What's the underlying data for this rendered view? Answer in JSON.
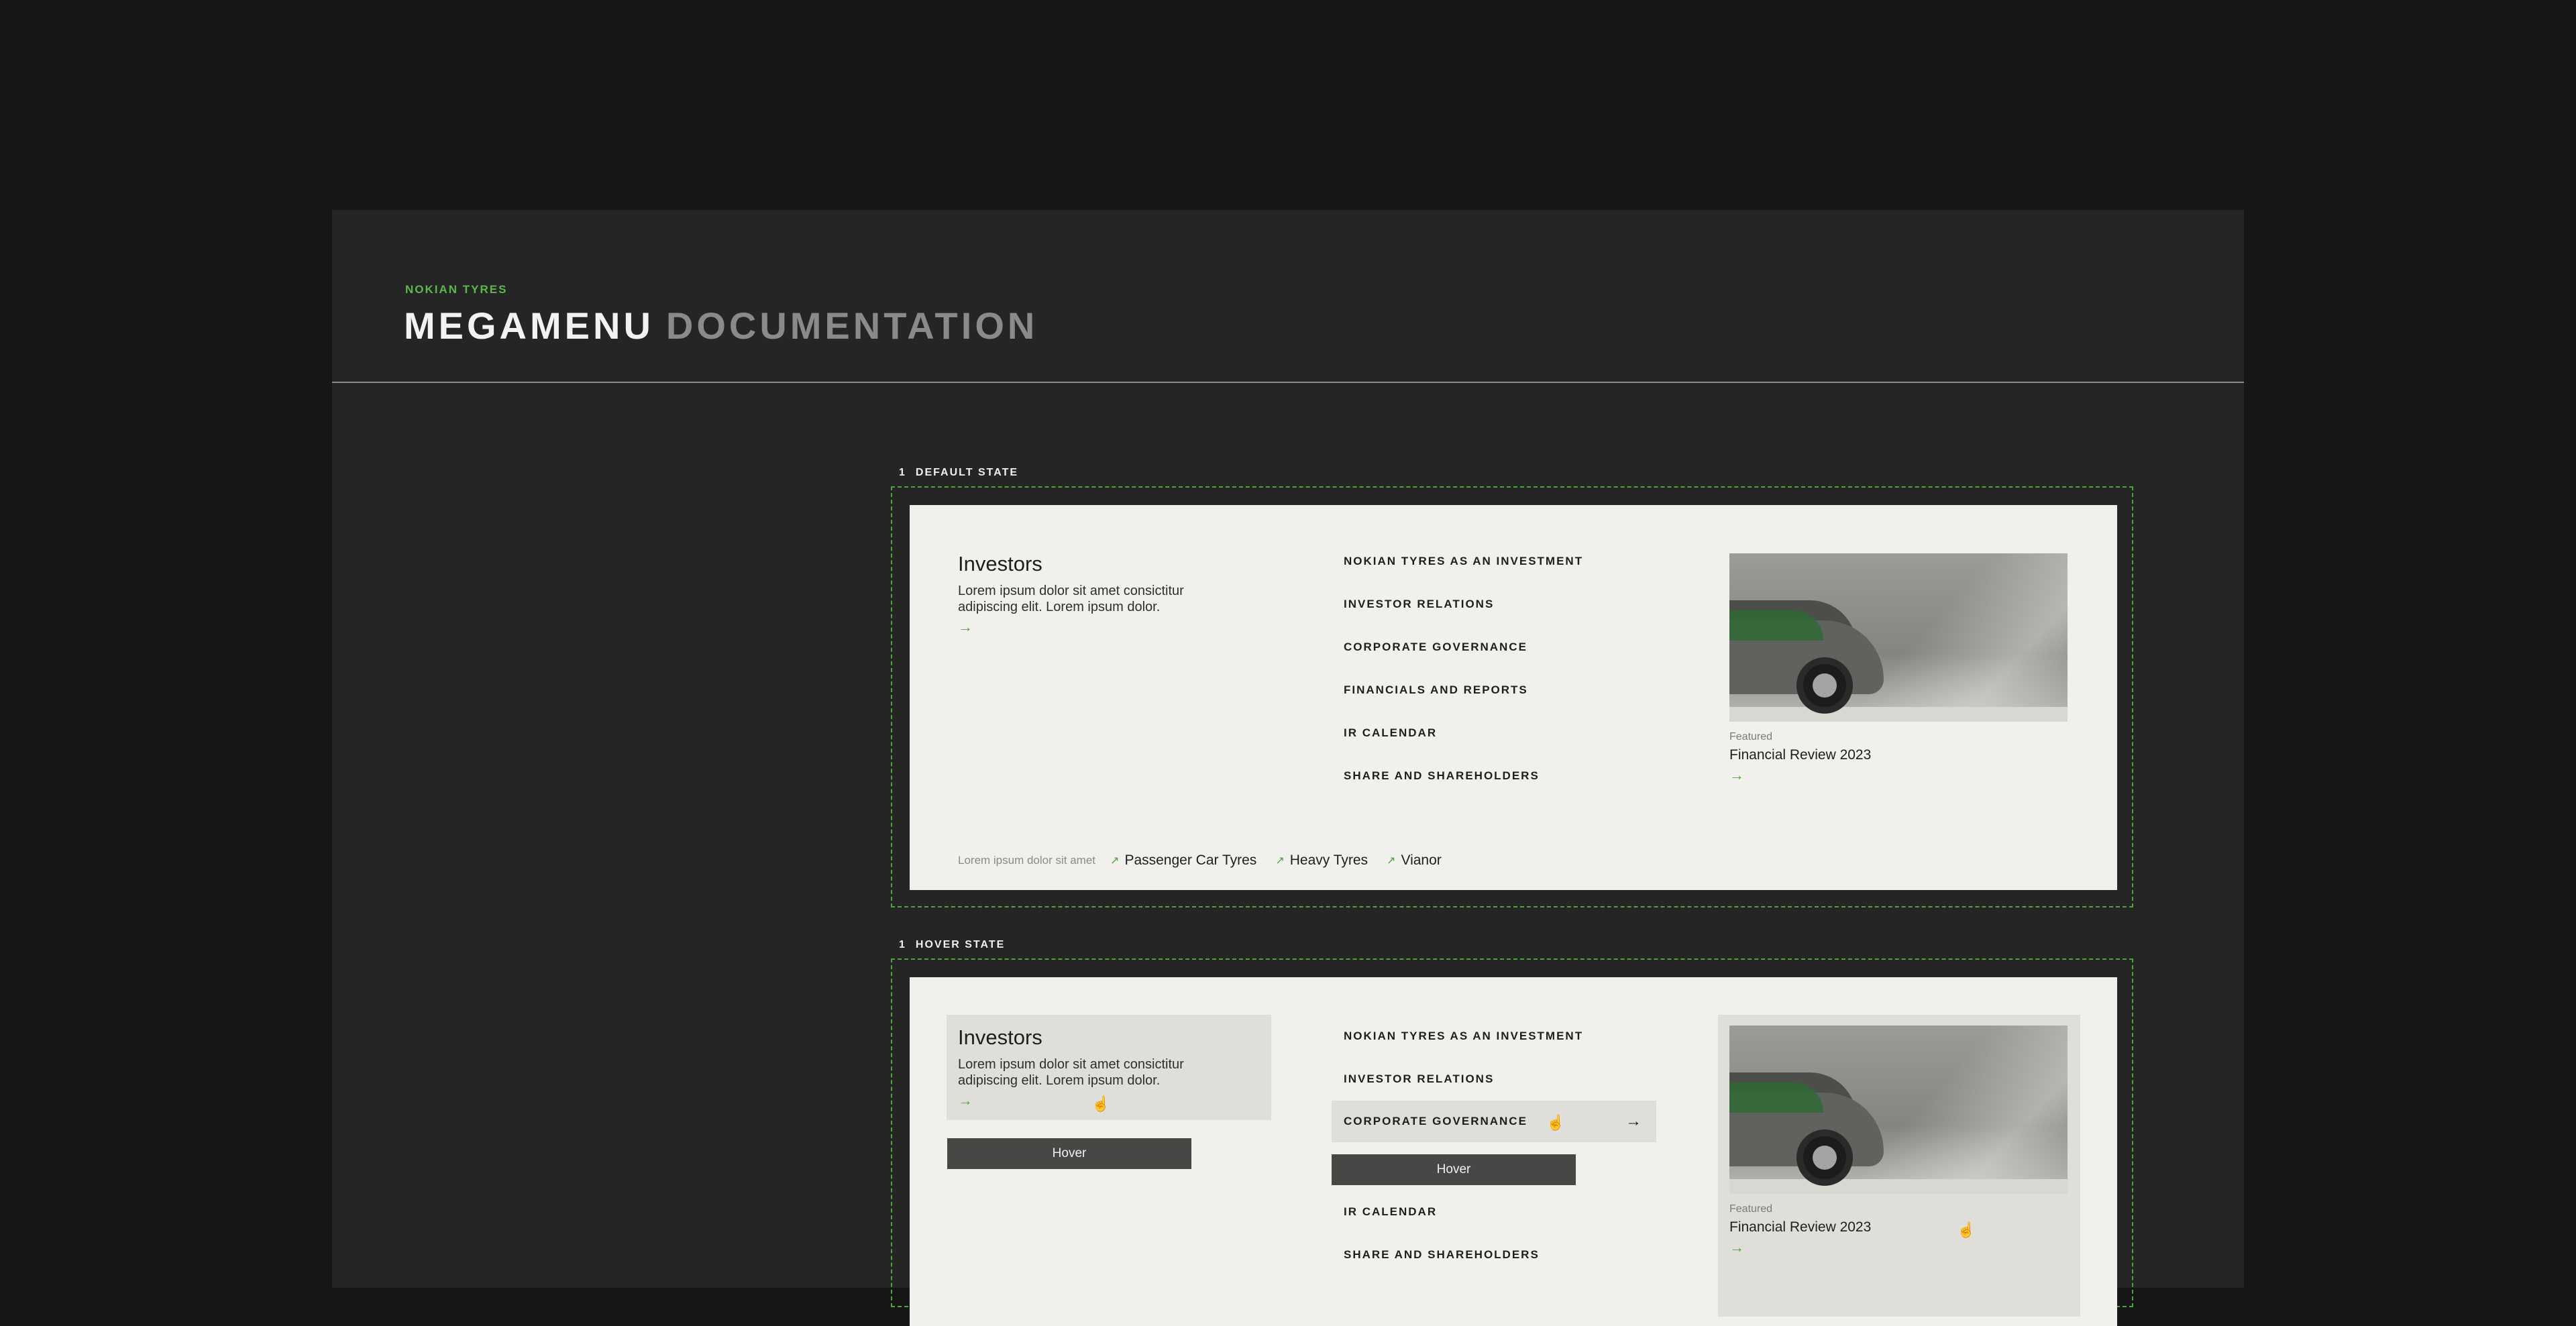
{
  "header": {
    "brand": "NOKIAN TYRES",
    "title_main": "MEGAMENU",
    "title_dim": "DOCUMENTATION"
  },
  "states": [
    {
      "number": "1",
      "label": "DEFAULT STATE"
    },
    {
      "number": "1",
      "label": "HOVER STATE"
    }
  ],
  "megamenu": {
    "intro": {
      "title": "Investors",
      "text": "Lorem ipsum dolor sit amet consictitur adipiscing elit. Lorem ipsum dolor.",
      "arrow": "→"
    },
    "nav": [
      {
        "label": "NOKIAN TYRES AS AN INVESTMENT"
      },
      {
        "label": "INVESTOR RELATIONS"
      },
      {
        "label": "CORPORATE GOVERNANCE"
      },
      {
        "label": "FINANCIALS AND REPORTS"
      },
      {
        "label": "IR CALENDAR"
      },
      {
        "label": "SHARE AND SHAREHOLDERS"
      }
    ],
    "feature": {
      "kicker": "Featured",
      "title": "Financial Review 2023",
      "arrow": "→",
      "image_icon": "car-photo"
    },
    "footer": {
      "lead": "Lorem ipsum dolor sit amet",
      "links": [
        {
          "label": "Passenger Car Tyres",
          "icon": "external-link-icon"
        },
        {
          "label": "Heavy Tyres",
          "icon": "external-link-icon"
        },
        {
          "label": "Vianor",
          "icon": "external-link-icon"
        }
      ]
    }
  },
  "hover_state": {
    "tag_label": "Hover",
    "nav_arrow": "→",
    "cursor_icon": "hand-pointer-icon"
  },
  "colors": {
    "accent": "#4ea33c",
    "panel_bg": "#f1f0ec",
    "doc_bg": "#252525",
    "hover_bg": "#e0ded8",
    "tag_bg": "#474745"
  }
}
